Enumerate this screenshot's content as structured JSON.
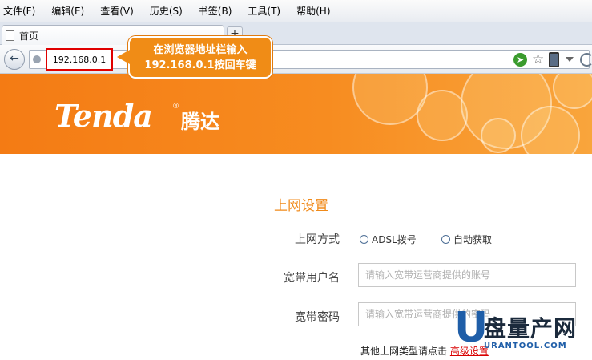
{
  "menu": [
    "文件(F)",
    "编辑(E)",
    "查看(V)",
    "历史(S)",
    "书签(B)",
    "工具(T)",
    "帮助(H)"
  ],
  "tab": {
    "label": "首页",
    "new_tab": "+"
  },
  "address": {
    "url": "192.168.0.1"
  },
  "callout": {
    "line1": "在浏览器地址栏输入",
    "line2": "192.168.0.1按回车键"
  },
  "banner": {
    "logo": "Tenda",
    "logo_cn": "腾达",
    "reg": "®"
  },
  "form": {
    "title": "上网设置",
    "mode_label": "上网方式",
    "mode_options": [
      "ADSL拨号",
      "自动获取"
    ],
    "user_label": "宽带用户名",
    "user_placeholder": "请输入宽带运营商提供的账号",
    "pass_label": "宽带密码",
    "pass_placeholder": "请输入宽带运营商提供的密码",
    "advanced_prefix": "其他上网类型请点击",
    "advanced_link": "高级设置"
  },
  "watermark": {
    "text": "盘量产网",
    "url": "URANTOOL.COM",
    "brand_color": "#1f5ea8"
  },
  "colors": {
    "accent": "#f08a1a",
    "callout": "#f08c16",
    "highlight": "#e00000"
  }
}
